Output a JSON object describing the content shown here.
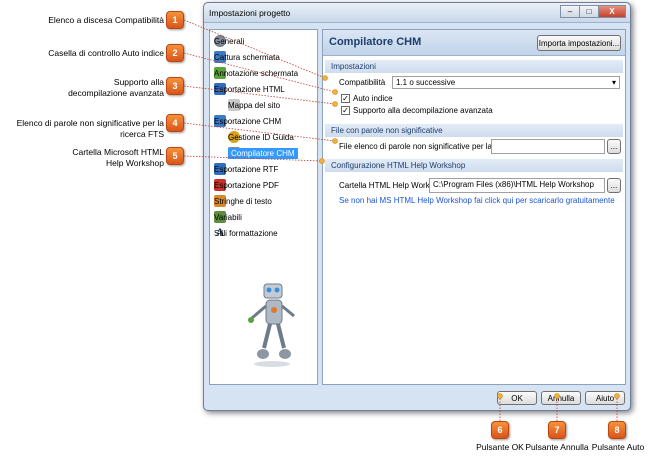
{
  "callouts": [
    {
      "num": "1",
      "text": "Elenco a discesa Compatibilità"
    },
    {
      "num": "2",
      "text": "Casella di controllo Auto indice"
    },
    {
      "num": "3",
      "text": "Supporto alla decompilazione avanzata"
    },
    {
      "num": "4",
      "text": "Elenco di parole non significative per la ricerca FTS"
    },
    {
      "num": "5",
      "text": "Cartella Microsoft HTML Help Workshop"
    },
    {
      "num": "6",
      "text": "Pulsante OK"
    },
    {
      "num": "7",
      "text": "Pulsante Annulla"
    },
    {
      "num": "8",
      "text": "Pulsante Auto"
    }
  ],
  "window": {
    "title": "Impostazioni progetto",
    "minimize": "–",
    "maximize": "□",
    "close": "X"
  },
  "nav": {
    "items": [
      {
        "label": "Generali",
        "icon": "gear-icon"
      },
      {
        "label": "Cattura schermata",
        "icon": "screenshot-icon"
      },
      {
        "label": "Annotazione schermata",
        "icon": "annotation-icon"
      },
      {
        "label": "Esportazione HTML",
        "icon": "html-export-icon"
      },
      {
        "label": "Mappa del sito",
        "icon": "sitemap-icon"
      },
      {
        "label": "Esportazione CHM",
        "icon": "chm-export-icon"
      },
      {
        "label": "Gestione ID Guida",
        "icon": "help-id-icon"
      },
      {
        "label": "Compilatore CHM",
        "icon": "compiler-icon"
      },
      {
        "label": "Esportazione RTF",
        "icon": "rtf-export-icon"
      },
      {
        "label": "Esportazione PDF",
        "icon": "pdf-export-icon"
      },
      {
        "label": "Stringhe di testo",
        "icon": "strings-icon"
      },
      {
        "label": "Variabili",
        "icon": "variables-icon"
      },
      {
        "label": "Stili formattazione",
        "icon": "styles-icon"
      }
    ]
  },
  "panel": {
    "title": "Compilatore CHM",
    "import_button": "Importa impostazioni...",
    "section_settings": "Impostazioni",
    "compat_label": "Compatibilità",
    "compat_value": "1.1 o successive",
    "auto_index_label": "Auto indice",
    "decompile_label": "Supporto alla decompilazione avanzata",
    "section_stopwords": "File con parole non significative",
    "stopwords_label": "File elenco di parole non significative per la ricerca",
    "stopwords_value": "",
    "browse_label": "...",
    "section_workshop": "Configurazione HTML Help Workshop",
    "workshop_label": "Cartella HTML Help Workshop",
    "workshop_value": "C:\\Program Files (x86)\\HTML Help Workshop",
    "download_link": "Se non hai MS HTML Help Workshop fai click qui per scaricarlo gratuitamente"
  },
  "footer": {
    "ok": "OK",
    "cancel": "Annulla",
    "help": "Aiuto"
  }
}
